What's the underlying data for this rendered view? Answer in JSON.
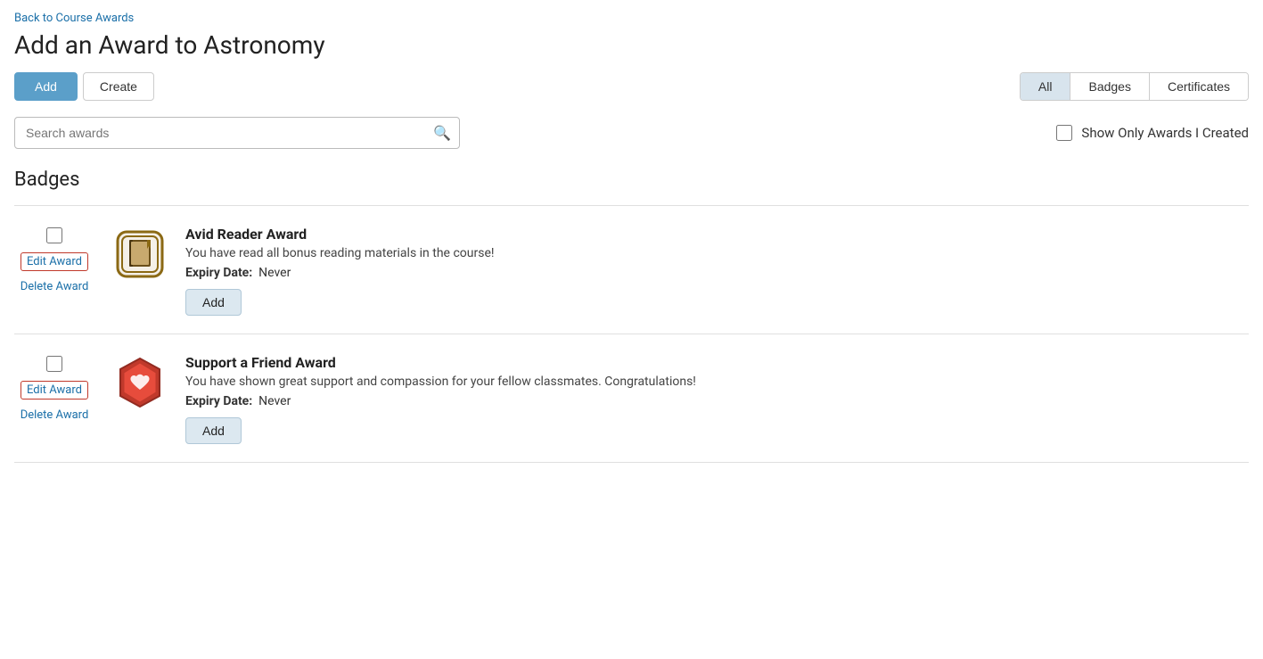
{
  "navigation": {
    "back_link": "Back to Course Awards"
  },
  "header": {
    "title": "Add an Award to Astronomy"
  },
  "toolbar": {
    "add_label": "Add",
    "create_label": "Create"
  },
  "type_tabs": {
    "items": [
      {
        "label": "All",
        "active": true
      },
      {
        "label": "Badges",
        "active": false
      },
      {
        "label": "Certificates",
        "active": false
      }
    ]
  },
  "search": {
    "placeholder": "Search awards"
  },
  "filter": {
    "show_only_label": "Show Only Awards I Created"
  },
  "badges_section": {
    "title": "Badges",
    "items": [
      {
        "name": "Avid Reader Award",
        "description": "You have read all bonus reading materials in the course!",
        "expiry_label": "Expiry Date:",
        "expiry_value": "Never",
        "add_label": "Add",
        "edit_label": "Edit Award",
        "delete_label": "Delete Award",
        "icon_type": "book"
      },
      {
        "name": "Support a Friend Award",
        "description": "You have shown great support and compassion for your fellow classmates. Congratulations!",
        "expiry_label": "Expiry Date:",
        "expiry_value": "Never",
        "add_label": "Add",
        "edit_label": "Edit Award",
        "delete_label": "Delete Award",
        "icon_type": "handshake"
      }
    ]
  }
}
